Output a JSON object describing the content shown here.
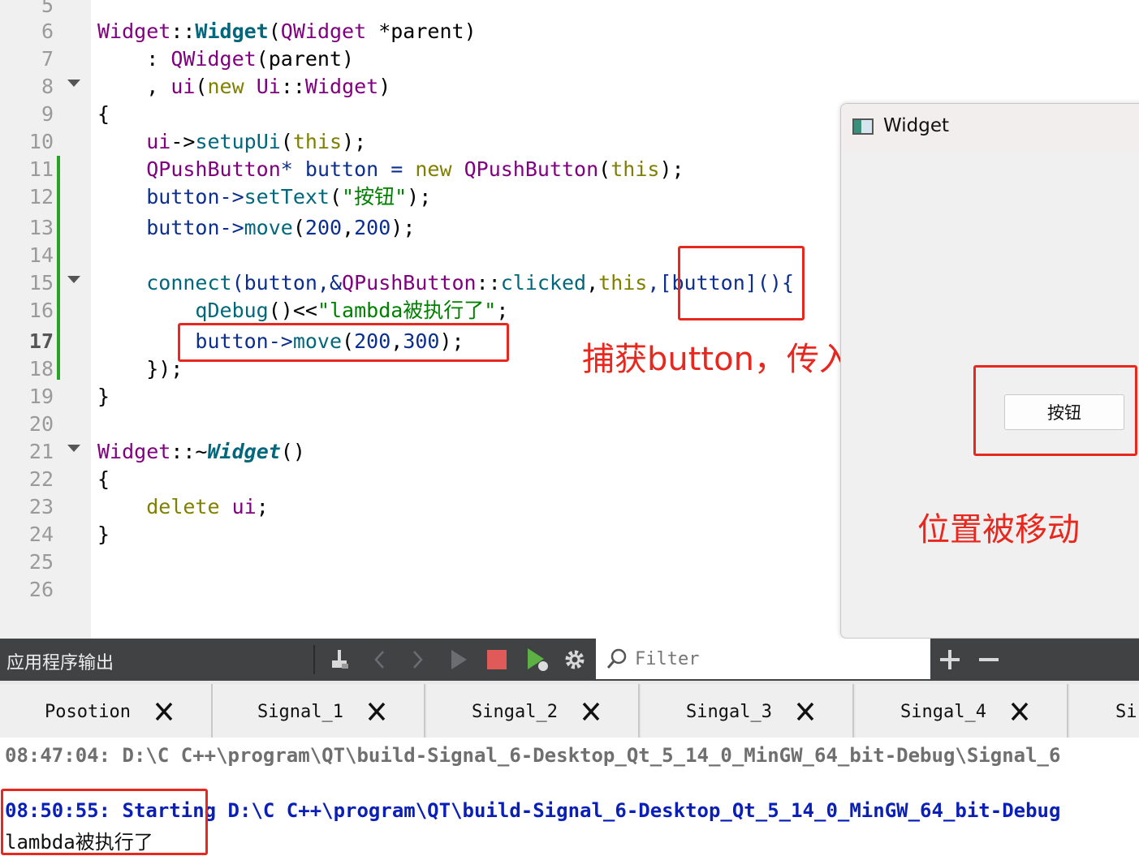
{
  "editor": {
    "line_numbers": [
      "5",
      "6",
      "7",
      "8",
      "9",
      "10",
      "11",
      "12",
      "13",
      "14",
      "15",
      "16",
      "17",
      "18",
      "19",
      "20",
      "21",
      "22",
      "23",
      "24",
      "25",
      "26"
    ],
    "current_line": "17",
    "lines": {
      "l6": [
        "Widget",
        "::",
        "Widget",
        "(",
        "QWidget",
        " *parent)"
      ],
      "l7": [
        "    : ",
        "QWidget",
        "(parent)"
      ],
      "l8": [
        "    , ",
        "ui",
        "(",
        "new",
        " ",
        "Ui",
        "::",
        "Widget",
        ")"
      ],
      "l9": [
        "{"
      ],
      "l10": [
        "    ",
        "ui",
        "->",
        "setupUi",
        "(",
        "this",
        ");"
      ],
      "l11": [
        "    ",
        "QPushButton",
        "* button = ",
        "new",
        " ",
        "QPushButton",
        "(",
        "this",
        ");"
      ],
      "l12": [
        "    button->",
        "setText",
        "(",
        "\"按钮\"",
        ");"
      ],
      "l13": [
        "    button->",
        "move",
        "(",
        "200",
        ",",
        "200",
        ");"
      ],
      "l15": [
        "    ",
        "connect",
        "(button,&",
        "QPushButton",
        "::",
        "clicked",
        ",",
        "this",
        ",[button](){"
      ],
      "l16": [
        "        ",
        "qDebug",
        "()<<",
        "\"lambda被执行了\"",
        ";"
      ],
      "l17": [
        "        button->",
        "move",
        "(",
        "200",
        ",",
        "300",
        ");"
      ],
      "l18": [
        "    });"
      ],
      "l19": [
        "}"
      ],
      "l21": [
        "Widget",
        "::",
        "~",
        "Widget",
        "()"
      ],
      "l22": [
        "{"
      ],
      "l23": [
        "    ",
        "delete",
        " ",
        "ui",
        ";"
      ],
      "l24": [
        "}"
      ]
    }
  },
  "annotations": {
    "capture_note": "捕获button，传入表达式",
    "moved_note": "位置被移动"
  },
  "widget_window": {
    "title": "Widget",
    "button_label": "按钮"
  },
  "output_pane": {
    "title": "应用程序输出",
    "filter_placeholder": "Filter",
    "tabs": [
      "Posotion",
      "Signal_1",
      "Singal_2",
      "Singal_3",
      "Singal_4",
      "Si"
    ],
    "line1_time": "08:47:04: ",
    "line1_text": "D:\\C C++\\program\\QT\\build-Signal_6-Desktop_Qt_5_14_0_MinGW_64_bit-Debug\\Signal_6",
    "line2_time": "08:50:55: ",
    "line2_text": "Starting D:\\C C++\\program\\QT\\build-Signal_6-Desktop_Qt_5_14_0_MinGW_64_bit-Debug",
    "line3_text": "lambda被执行了"
  },
  "icons": [
    "clear-icon",
    "prev-icon",
    "next-icon",
    "run-icon",
    "stop-icon",
    "debug-run-icon",
    "gear-icon",
    "search-icon",
    "plus-icon",
    "minus-icon",
    "close-icon",
    "window-icon"
  ],
  "colors": {
    "annotation_red": "#e8271e",
    "toolbar_bg": "#404244",
    "stop_red": "#e05a5a",
    "debug_green": "#5db044",
    "modified_marker": "#26a226",
    "output_blue": "#0a1fb8"
  }
}
